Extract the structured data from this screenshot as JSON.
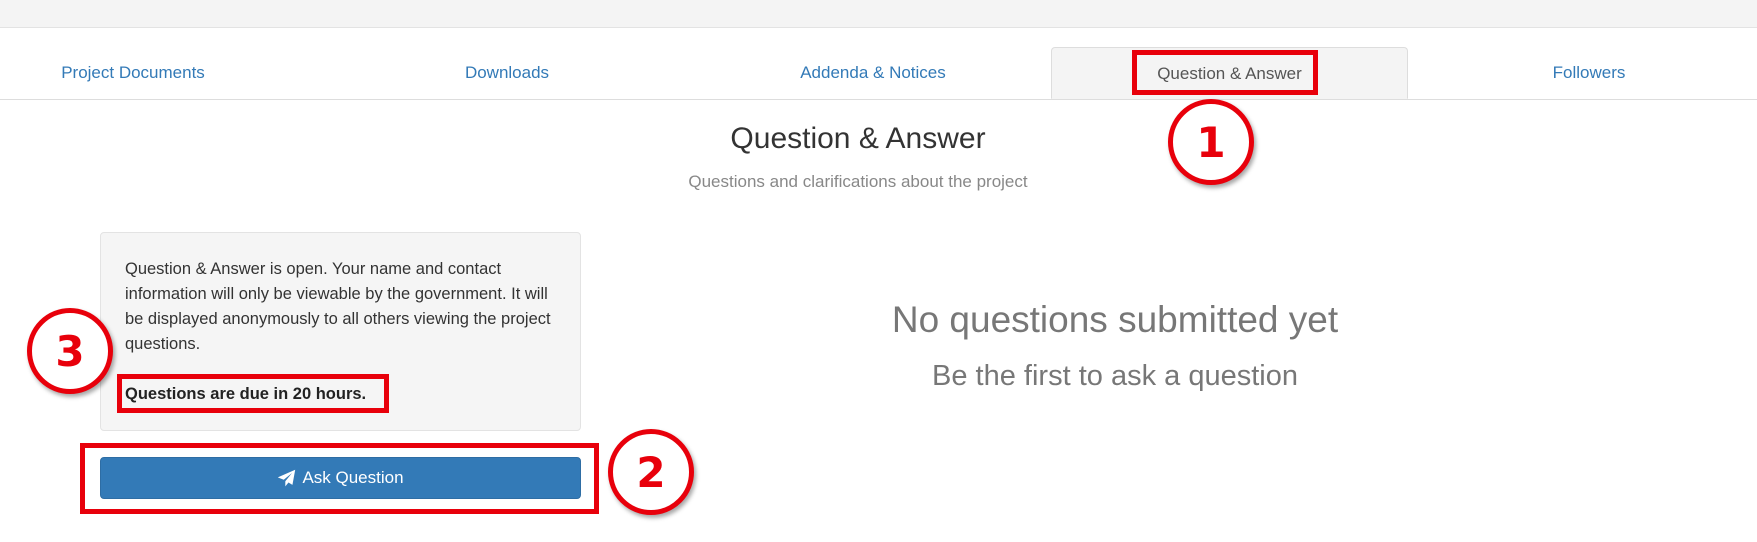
{
  "tabs": [
    {
      "label": "Project Documents"
    },
    {
      "label": "Downloads"
    },
    {
      "label": "Addenda & Notices"
    },
    {
      "label": "Question & Answer",
      "active": true
    },
    {
      "label": "Followers"
    }
  ],
  "section": {
    "title": "Question & Answer",
    "subtitle": "Questions and clarifications about the project"
  },
  "info": {
    "text": "Question & Answer is open. Your name and contact information will only be viewable by the government. It will be displayed anonymously to all others viewing the project questions.",
    "due": "Questions are due in 20 hours."
  },
  "ask_button": {
    "label": "Ask Question",
    "icon": "paper-plane-icon"
  },
  "empty_state": {
    "title": "No questions submitted yet",
    "subtitle": "Be the first to ask a question"
  },
  "annotations": {
    "color": "#e8000b",
    "callouts": [
      "1",
      "2",
      "3"
    ]
  },
  "colors": {
    "link": "#337ab7",
    "button": "#337ab7",
    "panel": "#f5f5f5"
  }
}
